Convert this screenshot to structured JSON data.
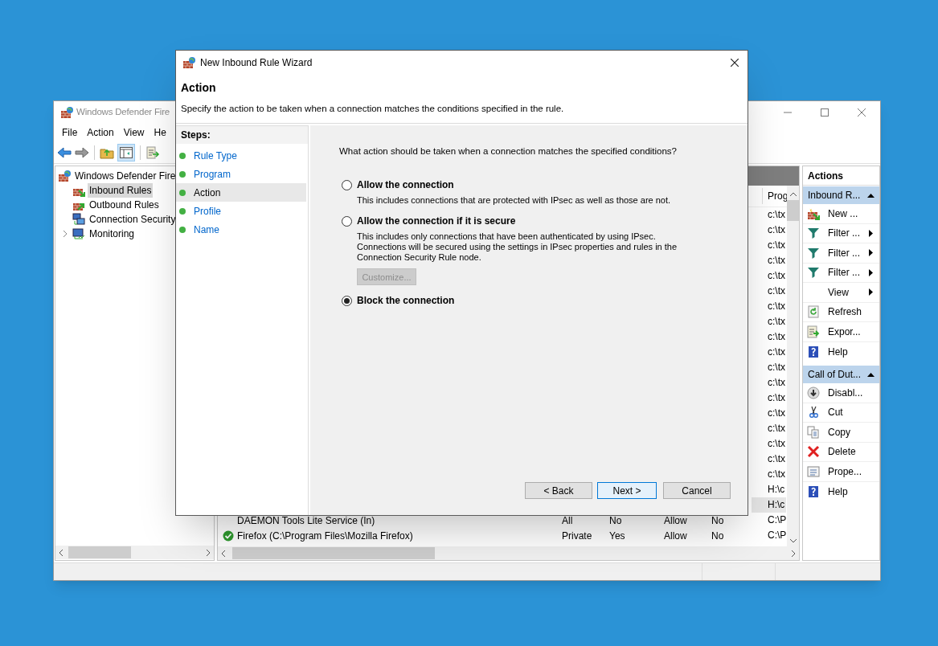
{
  "main_window": {
    "title": "Windows Defender Fire",
    "menu": [
      "File",
      "Action",
      "View",
      "He"
    ],
    "tree": {
      "root": "Windows Defender Fire",
      "items": [
        {
          "label": "Inbound Rules",
          "kind": "inbound",
          "selected": true,
          "expandable": false
        },
        {
          "label": "Outbound Rules",
          "kind": "outbound",
          "selected": false,
          "expandable": false
        },
        {
          "label": "Connection Security",
          "kind": "security",
          "selected": false,
          "expandable": false
        },
        {
          "label": "Monitoring",
          "kind": "monitoring",
          "selected": false,
          "expandable": true
        }
      ]
    },
    "table": {
      "columns": [
        "Prog"
      ],
      "rows": [
        {
          "program": "c:\\tx",
          "selected": false
        },
        {
          "program": "c:\\tx",
          "selected": false
        },
        {
          "program": "c:\\tx",
          "selected": false
        },
        {
          "program": "c:\\tx",
          "selected": false
        },
        {
          "program": "c:\\tx",
          "selected": false
        },
        {
          "program": "c:\\tx",
          "selected": false
        },
        {
          "program": "c:\\tx",
          "selected": false
        },
        {
          "program": "c:\\tx",
          "selected": false
        },
        {
          "program": "c:\\tx",
          "selected": false
        },
        {
          "program": "c:\\tx",
          "selected": false
        },
        {
          "program": "c:\\tx",
          "selected": false
        },
        {
          "program": "c:\\tx",
          "selected": false
        },
        {
          "program": "c:\\tx",
          "selected": false
        },
        {
          "program": "c:\\tx",
          "selected": false
        },
        {
          "program": "c:\\tx",
          "selected": false
        },
        {
          "program": "c:\\tx",
          "selected": false
        },
        {
          "program": "c:\\tx",
          "selected": false
        },
        {
          "program": "c:\\tx",
          "selected": false
        },
        {
          "program": "H:\\c",
          "selected": false
        },
        {
          "program": "H:\\c",
          "selected": true
        },
        {
          "name": "DAEMON Tools Lite Service (In)",
          "enabled_icon": false,
          "profile": "All",
          "enabled": "No",
          "action": "Allow",
          "override": "No",
          "program": "C:\\P",
          "selected": false
        },
        {
          "name": "Firefox (C:\\Program Files\\Mozilla Firefox)",
          "enabled_icon": true,
          "profile": "Private",
          "enabled": "Yes",
          "action": "Allow",
          "override": "No",
          "program": "C:\\P",
          "selected": false
        }
      ]
    },
    "actions_pane": {
      "title": "Actions",
      "groups": [
        {
          "title": "Inbound R...",
          "items": [
            {
              "label": "New ...",
              "kind": "new",
              "submenu": false
            },
            {
              "label": "Filter ...",
              "kind": "filter",
              "submenu": true
            },
            {
              "label": "Filter ...",
              "kind": "filter",
              "submenu": true
            },
            {
              "label": "Filter ...",
              "kind": "filter",
              "submenu": true
            },
            {
              "label": "View",
              "kind": "none",
              "submenu": true
            },
            {
              "label": "Refresh",
              "kind": "refresh",
              "submenu": false
            },
            {
              "label": "Expor...",
              "kind": "export",
              "submenu": false
            },
            {
              "label": "Help",
              "kind": "help",
              "submenu": false
            }
          ]
        },
        {
          "title": "Call of Dut...",
          "items": [
            {
              "label": "Disabl...",
              "kind": "disable",
              "submenu": false
            },
            {
              "label": "Cut",
              "kind": "cut",
              "submenu": false
            },
            {
              "label": "Copy",
              "kind": "copy",
              "submenu": false
            },
            {
              "label": "Delete",
              "kind": "delete",
              "submenu": false
            },
            {
              "label": "Prope...",
              "kind": "properties",
              "submenu": false
            },
            {
              "label": "Help",
              "kind": "help",
              "submenu": false
            }
          ]
        }
      ]
    }
  },
  "wizard": {
    "title": "New Inbound Rule Wizard",
    "heading": "Action",
    "description": "Specify the action to be taken when a connection matches the conditions specified in the rule.",
    "steps_title": "Steps:",
    "steps": [
      {
        "label": "Rule Type",
        "selected": false
      },
      {
        "label": "Program",
        "selected": false
      },
      {
        "label": "Action",
        "selected": true
      },
      {
        "label": "Profile",
        "selected": false
      },
      {
        "label": "Name",
        "selected": false
      }
    ],
    "question": "What action should be taken when a connection matches the specified conditions?",
    "options": [
      {
        "label": "Allow the connection",
        "description": "This includes connections that are protected with IPsec as well as those are not.",
        "selected": false
      },
      {
        "label": "Allow the connection if it is secure",
        "description": "This includes only connections that have been authenticated by using IPsec.  Connections will be secured using the settings in IPsec properties and rules in the Connection Security Rule node.",
        "selected": false,
        "button": {
          "label": "Customize...",
          "disabled": true
        }
      },
      {
        "label": "Block the connection",
        "selected": true
      }
    ],
    "buttons": [
      {
        "label": "< Back",
        "focused": false
      },
      {
        "label": "Next >",
        "focused": true
      },
      {
        "label": "Cancel",
        "focused": false
      }
    ]
  }
}
